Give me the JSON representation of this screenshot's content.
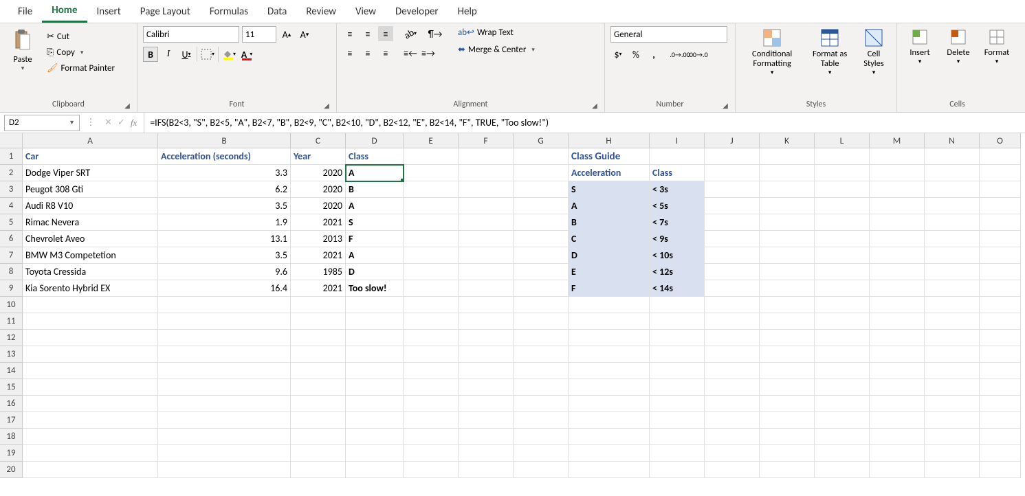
{
  "menu": [
    "File",
    "Home",
    "Insert",
    "Page Layout",
    "Formulas",
    "Data",
    "Review",
    "View",
    "Developer",
    "Help"
  ],
  "menu_active": "Home",
  "ribbon": {
    "clipboard": {
      "paste": "Paste",
      "cut": "Cut",
      "copy": "Copy",
      "fmt": "Format Painter",
      "label": "Clipboard"
    },
    "font": {
      "name": "Calibri",
      "size": "11",
      "label": "Font"
    },
    "alignment": {
      "wrap": "Wrap Text",
      "merge": "Merge & Center",
      "label": "Alignment"
    },
    "number": {
      "fmt": "General",
      "label": "Number"
    },
    "styles": {
      "cond": "Conditional Formatting",
      "table": "Format as Table",
      "cell": "Cell Styles",
      "label": "Styles"
    },
    "cells": {
      "ins": "Insert",
      "del": "Delete",
      "fmt": "Format",
      "label": "Cells"
    }
  },
  "name_box": "D2",
  "formula": "=IFS(B2<3, \"S\", B2<5, \"A\", B2<7, \"B\", B2<9, \"C\", B2<10, \"D\", B2<12, \"E\", B2<14, \"F\", TRUE, \"Too slow!\")",
  "columns": [
    "A",
    "B",
    "C",
    "D",
    "E",
    "F",
    "G",
    "H",
    "I",
    "J",
    "K",
    "L",
    "M",
    "N",
    "O"
  ],
  "headers": {
    "car": "Car",
    "accel": "Acceleration (seconds)",
    "year": "Year",
    "class": "Class"
  },
  "cars": [
    {
      "name": "Dodge Viper SRT",
      "accel": "3.3",
      "year": "2020",
      "class": "A"
    },
    {
      "name": "Peugot 308 Gti",
      "accel": "6.2",
      "year": "2020",
      "class": "B"
    },
    {
      "name": "Audi R8 V10",
      "accel": "3.5",
      "year": "2020",
      "class": "A"
    },
    {
      "name": "Rimac Nevera",
      "accel": "1.9",
      "year": "2021",
      "class": "S"
    },
    {
      "name": "Chevrolet Aveo",
      "accel": "13.1",
      "year": "2013",
      "class": "F"
    },
    {
      "name": "BMW M3 Competetion",
      "accel": "3.5",
      "year": "2021",
      "class": "A"
    },
    {
      "name": "Toyota Cressida",
      "accel": "9.6",
      "year": "1985",
      "class": "D"
    },
    {
      "name": "Kia Sorento Hybrid EX",
      "accel": "16.4",
      "year": "2021",
      "class": "Too slow!"
    }
  ],
  "guide": {
    "title": "Class Guide",
    "h1": "Acceleration",
    "h2": "Class",
    "rows": [
      {
        "g": "S",
        "v": "< 3s"
      },
      {
        "g": "A",
        "v": "< 5s"
      },
      {
        "g": "B",
        "v": "< 7s"
      },
      {
        "g": "C",
        "v": "< 9s"
      },
      {
        "g": "D",
        "v": "< 10s"
      },
      {
        "g": "E",
        "v": "< 12s"
      },
      {
        "g": "F",
        "v": "< 14s"
      }
    ]
  },
  "empty_rows": [
    10,
    11,
    12,
    13,
    14,
    15,
    16,
    17,
    18,
    19,
    20
  ]
}
